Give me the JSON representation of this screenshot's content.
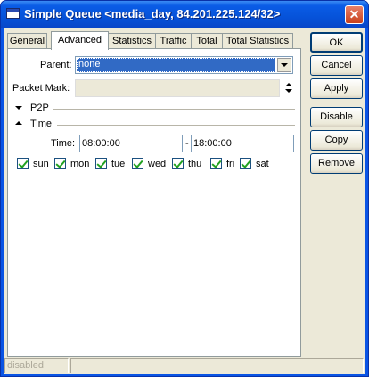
{
  "window": {
    "title": "Simple Queue <media_day, 84.201.225.124/32>",
    "close_glyph": "✕"
  },
  "tabs": [
    {
      "label": "General"
    },
    {
      "label": "Advanced",
      "active": true
    },
    {
      "label": "Statistics"
    },
    {
      "label": "Traffic"
    },
    {
      "label": "Total"
    },
    {
      "label": "Total Statistics"
    }
  ],
  "advanced": {
    "parent_label": "Parent:",
    "parent_value": "none",
    "packet_mark_label": "Packet Mark:",
    "packet_mark_value": "",
    "p2p_label": "P2P",
    "time_section_label": "Time",
    "time_label": "Time:",
    "time_start": "08:00:00",
    "time_separator": "-",
    "time_end": "18:00:00",
    "days": [
      {
        "label": "sun",
        "checked": true
      },
      {
        "label": "mon",
        "checked": true
      },
      {
        "label": "tue",
        "checked": true
      },
      {
        "label": "wed",
        "checked": true
      },
      {
        "label": "thu",
        "checked": true
      },
      {
        "label": "fri",
        "checked": true
      },
      {
        "label": "sat",
        "checked": true
      }
    ]
  },
  "buttons": {
    "ok": "OK",
    "cancel": "Cancel",
    "apply": "Apply",
    "disable": "Disable",
    "copy": "Copy",
    "remove": "Remove"
  },
  "status": {
    "state": "disabled",
    "extra": ""
  },
  "colors": {
    "titlebar": "#0653da",
    "selection": "#316ac5",
    "face": "#ece9d8",
    "checkmark": "#21a121"
  }
}
